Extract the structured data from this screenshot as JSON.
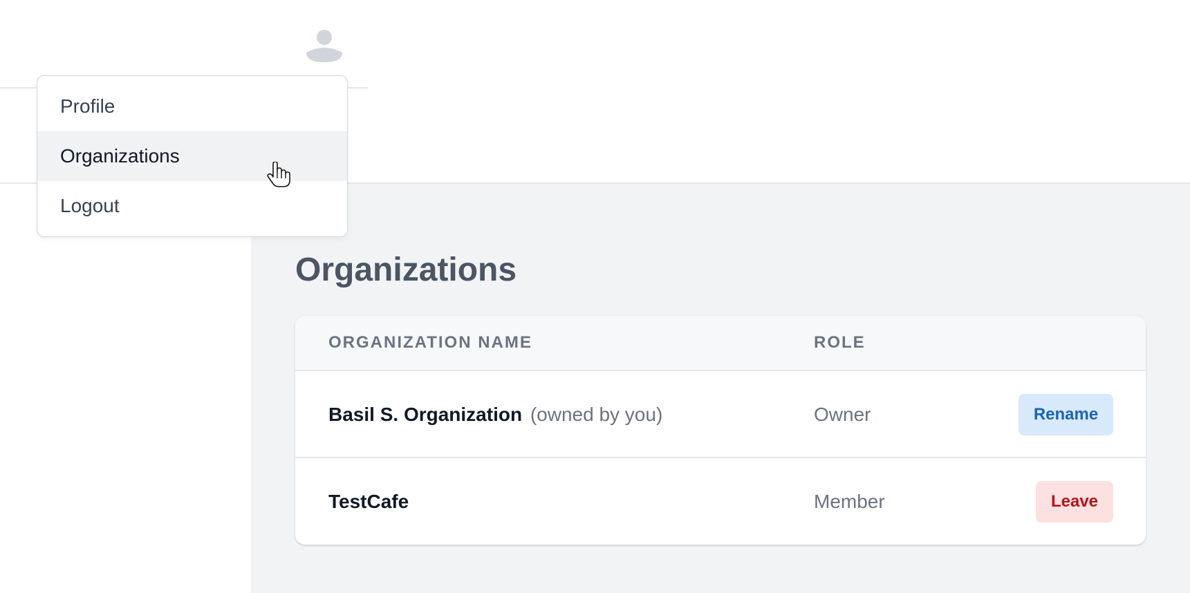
{
  "user_menu": {
    "avatar_icon": "user-avatar-icon",
    "items": [
      {
        "label": "Profile"
      },
      {
        "label": "Organizations",
        "hovered": true
      },
      {
        "label": "Logout"
      }
    ]
  },
  "main": {
    "title": "Organizations",
    "table": {
      "headers": {
        "name": "ORGANIZATION NAME",
        "role": "ROLE"
      },
      "rows": [
        {
          "name": "Basil S. Organization",
          "note": "(owned by you)",
          "role": "Owner",
          "action": "Rename"
        },
        {
          "name": "TestCafe",
          "note": "",
          "role": "Member",
          "action": "Leave"
        }
      ]
    }
  },
  "colors": {
    "rename_bg": "#d7e9fb",
    "rename_text": "#1d63b4",
    "leave_bg": "#fde0e0",
    "leave_text": "#b3151b",
    "main_bg": "#f2f3f5"
  }
}
